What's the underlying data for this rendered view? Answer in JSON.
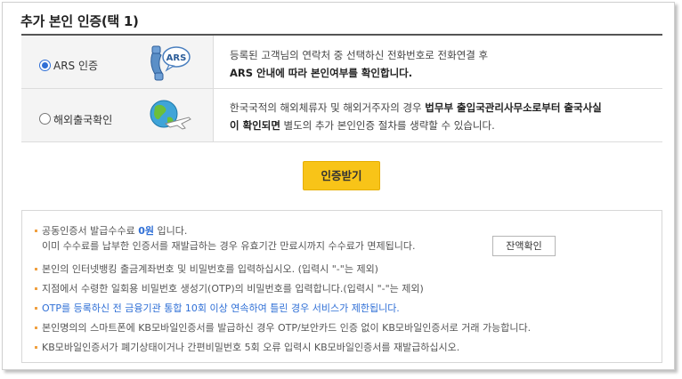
{
  "page": {
    "title": "추가 본인 인증(택 1)"
  },
  "options": [
    {
      "label": "ARS 인증",
      "selected": true,
      "icon": "ars-phone-icon",
      "desc_line1": "등록된 고객님의 연락처 중 선택하신 전화번호로 전화연결 후",
      "desc_line2": "ARS 안내에 따라 본인여부를 확인합니다."
    },
    {
      "label": "해외출국확인",
      "selected": false,
      "icon": "globe-airplane-icon",
      "desc_line1_a": "한국국적의 해외체류자 및 해외거주자의 경우 ",
      "desc_line1_b": "법무부 출입국관리사무소로부터 출국사실",
      "desc_line2_a": "이 확인되면",
      "desc_line2_b": " 별도의 추가 본인인증 절차를 생략할 수 있습니다."
    }
  ],
  "cert_button": "인증받기",
  "notes": {
    "fee_a": "공동인증서 발급수수료 ",
    "fee_b": "0원",
    "fee_c": " 입니다.",
    "fee_line2": "이미 수수료를 납부한 인증서를 재발급하는 경우 유효기간 만료시까지 수수료가 면제됩니다.",
    "balance_button": "잔액확인",
    "n2": "본인의 인터넷뱅킹 출금계좌번호 및 비밀번호를 입력하십시오. (입력시 \"-\"는 제외)",
    "n3": "지점에서 수령한 일회용 비밀번호 생성기(OTP)의 비밀번호를 입력합니다.(입력시 \"-\"는 제외)",
    "n4": "OTP를 등록하신 전 금융기관 통합 10회 이상 연속하여 틀린 경우 서비스가 제한됩니다.",
    "n5": "본인명의의 스마트폰에 KB모바일인증서를 발급하신 경우 OTP/보안카드 인증 없이 KB모바일인증서로 거래 가능합니다.",
    "n6": "KB모바일인증서가 폐기상태이거나 간편비밀번호 5회 오류 입력시 KB모바일인증서를 재발급하십시오."
  },
  "colors": {
    "accent": "#f8c418",
    "link_blue": "#2f6fd6",
    "bullet": "#f0a040"
  }
}
